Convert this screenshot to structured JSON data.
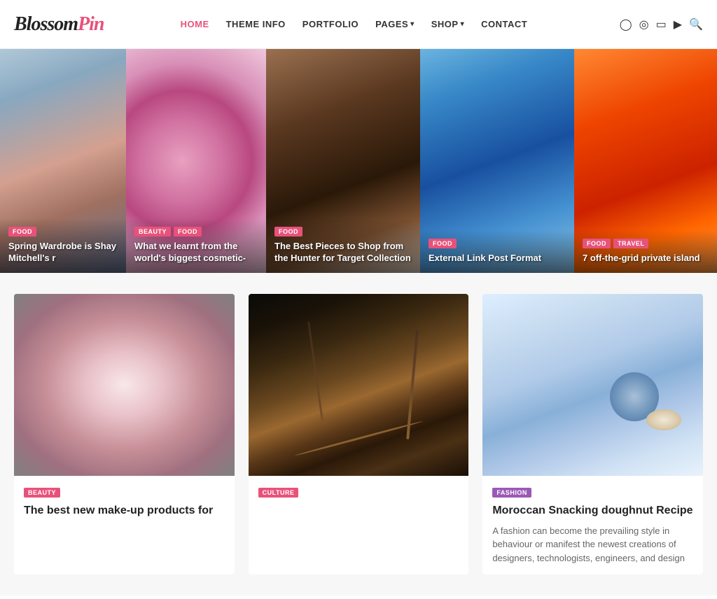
{
  "header": {
    "logo_blossom": "Blossom",
    "logo_pin": "Pin",
    "nav": [
      {
        "label": "HOME",
        "active": true,
        "dropdown": false
      },
      {
        "label": "THEME INFO",
        "active": false,
        "dropdown": false
      },
      {
        "label": "PORTFOLIO",
        "active": false,
        "dropdown": false
      },
      {
        "label": "PAGES",
        "active": false,
        "dropdown": true
      },
      {
        "label": "SHOP",
        "active": false,
        "dropdown": true
      },
      {
        "label": "CONTACT",
        "active": false,
        "dropdown": false
      }
    ],
    "icons": [
      "f",
      "instagram",
      "pinterest",
      "linkedin",
      "youtube",
      "search"
    ]
  },
  "hero": {
    "cards": [
      {
        "tags": [
          "FOOD"
        ],
        "title": "Spring Wardrobe is Shay Mitchell's r",
        "bg": "fashion"
      },
      {
        "tags": [
          "BEAUTY",
          "FOOD"
        ],
        "title": "What we learnt from the world's biggest cosmetic-",
        "bg": "beauty"
      },
      {
        "tags": [
          "FOOD"
        ],
        "title": "The Best Pieces to Shop from the Hunter for Target Collection",
        "bg": "shop"
      },
      {
        "tags": [
          "FOOD"
        ],
        "title": "External Link Post Format",
        "bg": "travel"
      },
      {
        "tags": [
          "FOOD",
          "TRAVEL"
        ],
        "title": "7 off-the-grid private island",
        "bg": "island"
      }
    ]
  },
  "posts": [
    {
      "tag": "BEAUTY",
      "title": "The best new make-up products for",
      "excerpt": "",
      "bg": "makeup"
    },
    {
      "tag": "CULTURE",
      "title": "",
      "excerpt": "",
      "bg": "spices"
    },
    {
      "tag": "FASHION",
      "title": "Moroccan Snacking doughnut Recipe",
      "excerpt": "A fashion can become the prevailing style in behaviour or manifest the newest creations of designers, technologists, engineers, and design",
      "bg": "winter"
    }
  ]
}
